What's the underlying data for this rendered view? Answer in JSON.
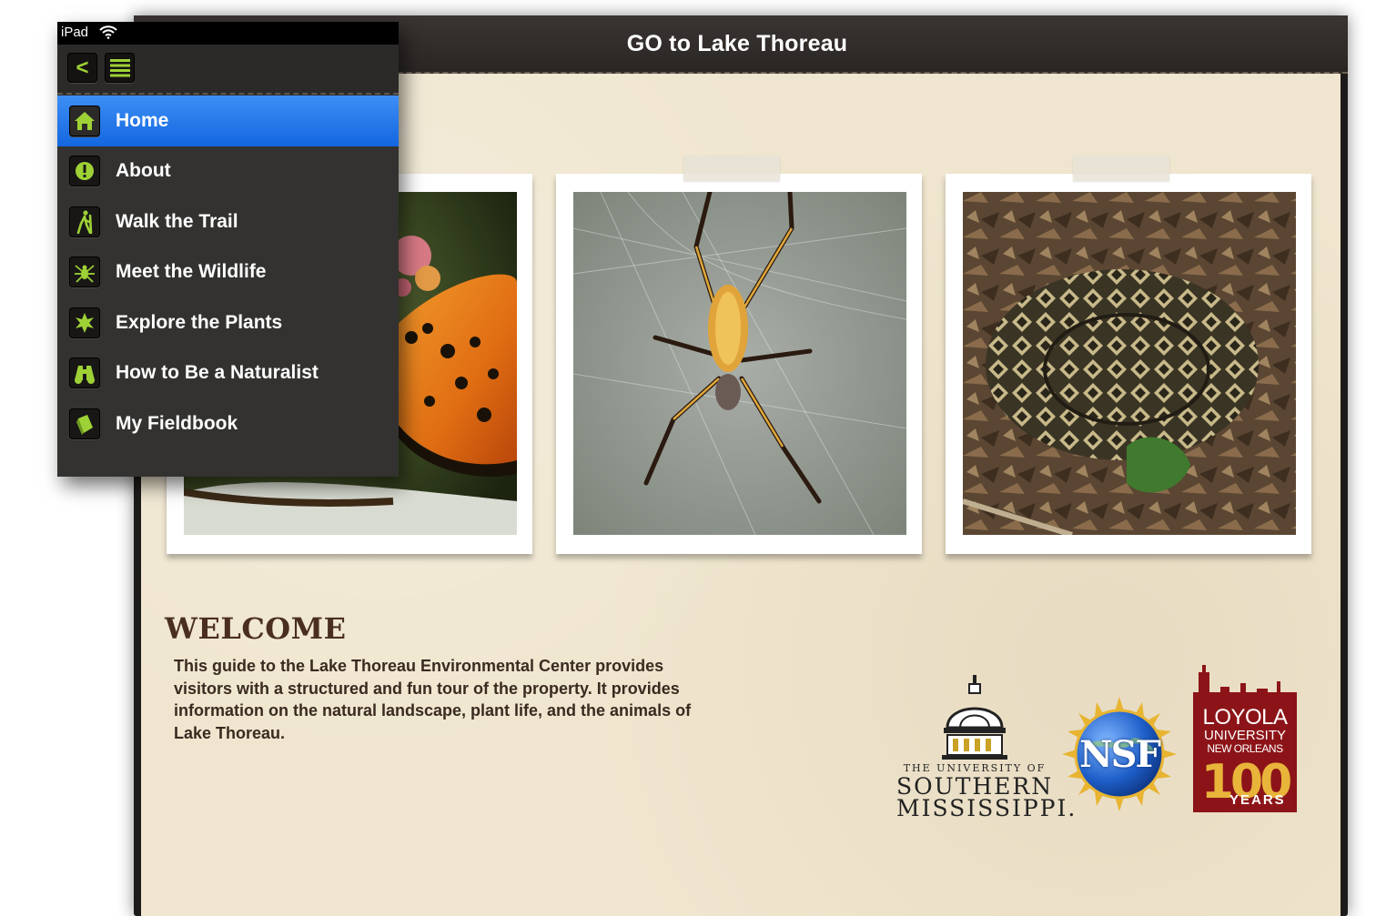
{
  "status_bar": {
    "device": "iPad"
  },
  "app": {
    "title": "GO to Lake Thoreau"
  },
  "menu": {
    "back_label": "<",
    "items": [
      {
        "label": "Home",
        "icon": "home-icon",
        "active": true
      },
      {
        "label": "About",
        "icon": "info-icon",
        "active": false
      },
      {
        "label": "Walk the Trail",
        "icon": "hiker-icon",
        "active": false
      },
      {
        "label": "Meet the Wildlife",
        "icon": "spider-icon",
        "active": false
      },
      {
        "label": "Explore the Plants",
        "icon": "leaf-icon",
        "active": false
      },
      {
        "label": "How to Be a Naturalist",
        "icon": "binoculars-icon",
        "active": false
      },
      {
        "label": "My Fieldbook",
        "icon": "book-icon",
        "active": false
      }
    ]
  },
  "photos": [
    {
      "subject": "butterfly-photo"
    },
    {
      "subject": "spider-photo"
    },
    {
      "subject": "rattlesnake-photo"
    }
  ],
  "welcome": {
    "title": "WELCOME",
    "body": "This guide to the Lake Thoreau Environmental Center provides visitors with a structured and fun tour of the property. It provides information on the natural landscape, plant life, and the animals of Lake Thoreau."
  },
  "logos": {
    "usm_line1": "THE UNIVERSITY OF",
    "usm_line2": "SOUTHERN",
    "usm_line3": "MISSISSIPPI.",
    "nsf": "NSF",
    "loyola_line1": "LOYOLA",
    "loyola_line2": "UNIVERSITY",
    "loyola_line3": "NEW ORLEANS",
    "loyola_100": "100",
    "loyola_years": "YEARS"
  },
  "colors": {
    "accent_green": "#9ed136",
    "active_blue": "#1466e0",
    "paper": "#f0e6cf",
    "loyola_red": "#8c1418"
  }
}
